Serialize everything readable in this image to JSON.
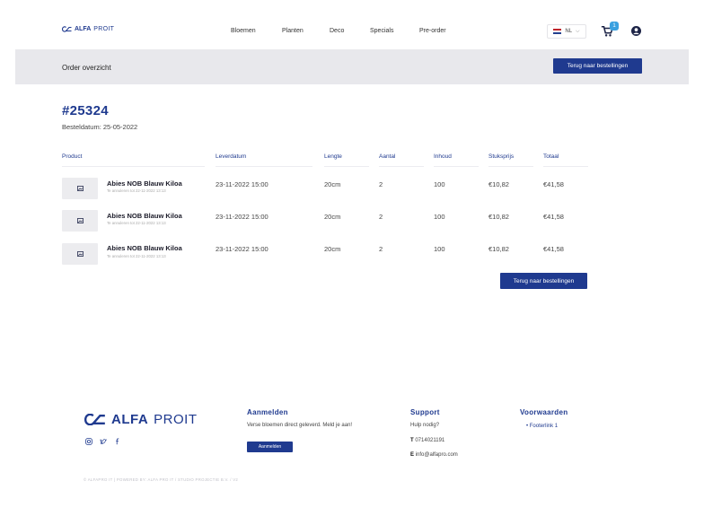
{
  "header": {
    "logo": {
      "alfa": "ALFA",
      "proit": "PROIT"
    },
    "nav": [
      "Bloemen",
      "Planten",
      "Deco",
      "Specials",
      "Pre-order"
    ],
    "language": "NL",
    "cart_count": "1"
  },
  "subheader": {
    "title": "Order overzicht",
    "back_button": "Terug naar bestellingen"
  },
  "order": {
    "number": "#25324",
    "date_label": "Besteldatum: 25-05-2022"
  },
  "table": {
    "headers": [
      "Product",
      "Leverdatum",
      "Lengte",
      "Aantal",
      "Inhoud",
      "Stuksprijs",
      "Totaal"
    ],
    "rows": [
      {
        "name": "Abies NOB Blauw Kiloa",
        "sub": "Te annuleren tot 22-11-2022 13:13",
        "date": "23-11-2022 15:00",
        "length": "20cm",
        "qty": "2",
        "content": "100",
        "price": "€10,82",
        "total": "€41,58"
      },
      {
        "name": "Abies NOB Blauw Kiloa",
        "sub": "Te annuleren tot 22-11-2022 13:13",
        "date": "23-11-2022 15:00",
        "length": "20cm",
        "qty": "2",
        "content": "100",
        "price": "€10,82",
        "total": "€41,58"
      },
      {
        "name": "Abies NOB Blauw Kiloa",
        "sub": "Te annuleren tot 22-11-2022 13:13",
        "date": "23-11-2022 15:00",
        "length": "20cm",
        "qty": "2",
        "content": "100",
        "price": "€10,82",
        "total": "€41,58"
      }
    ],
    "back_button": "Terug naar bestellingen"
  },
  "footer": {
    "logo": {
      "alfa": "ALFA",
      "proit": "PROIT"
    },
    "signup": {
      "heading": "Aanmelden",
      "text": "Verse bloemen direct geleverd. Meld je aan!",
      "button": "Aanmelden"
    },
    "support": {
      "heading": "Support",
      "help": "Hulp nodig?",
      "phone_label": "T",
      "phone": "0714021191",
      "email_label": "E",
      "email": "info@alfapro.com"
    },
    "terms": {
      "heading": "Voorwaarden",
      "link": "• Footerlink 1"
    },
    "copyright": "© ALFAPRO IT | POWERED BY: ALFA PRO IT / STUDIO PROJECTIE B.V. / V2"
  },
  "colors": {
    "brand": "#1f3a8f",
    "accent": "#3aa1e0",
    "subbar": "#e8e8ec"
  },
  "icons": [
    "alfa-logo-icon",
    "flag-nl-icon",
    "chevron-down-icon",
    "cart-icon",
    "user-icon",
    "image-placeholder-icon",
    "instagram-icon",
    "twitter-icon",
    "facebook-icon"
  ]
}
